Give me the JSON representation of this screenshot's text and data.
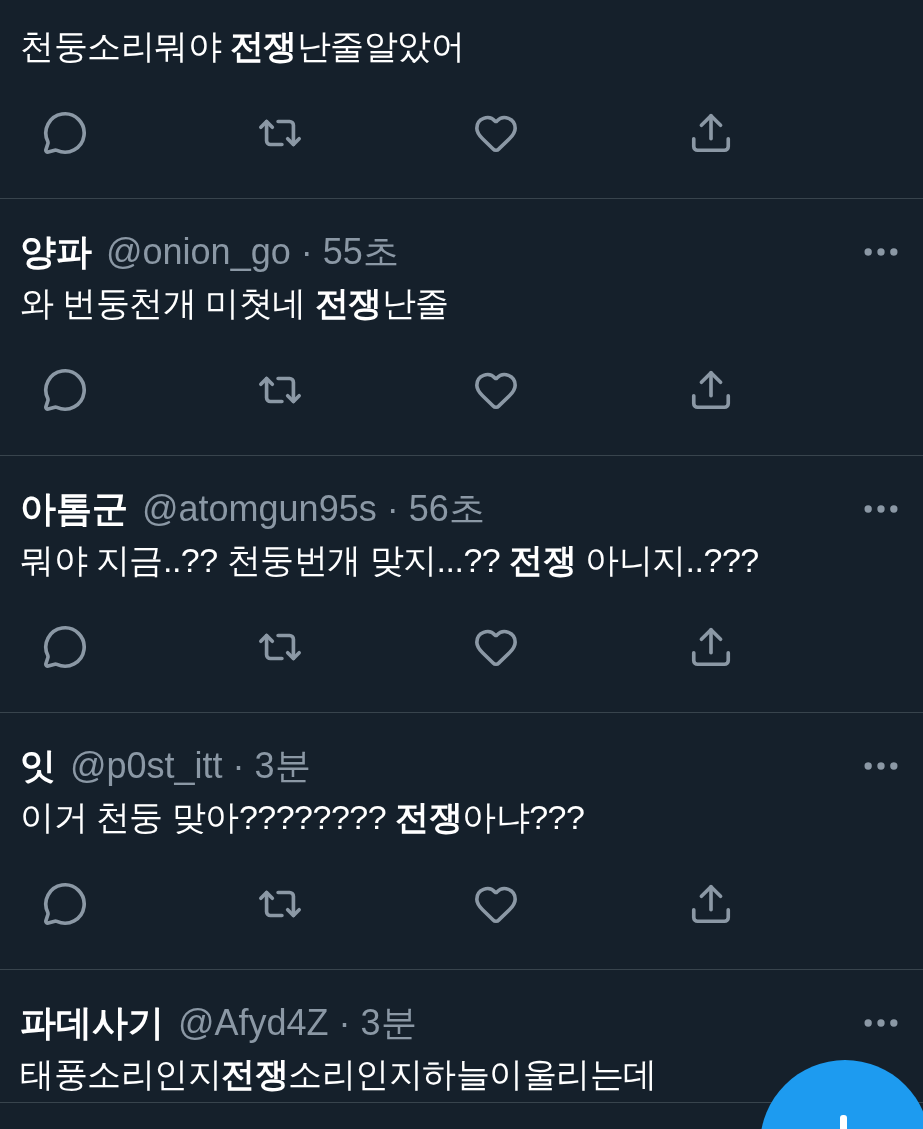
{
  "tweets": [
    {
      "text": "천둥소리뭐야 **전쟁**난줄알았어"
    },
    {
      "name": "양파",
      "meta": "@onion_go · 55초",
      "text": "와 번둥천개 미쳣네 **전쟁**난줄"
    },
    {
      "name": "아톰군",
      "meta": "@atomgun95s · 56초",
      "text": "뭐야 지금..?? 천둥번개 맞지...?? **전쟁** 아니지..???"
    },
    {
      "name": "잇",
      "meta": "@p0st_itt · 3분",
      "text": "이거 천둥 맞아???????? **전쟁**아냐???"
    },
    {
      "name": "파데사기",
      "meta": "@Afyd4Z · 3분",
      "text": "태풍소리인지**전쟁**소리인지하늘이울리는데"
    }
  ]
}
